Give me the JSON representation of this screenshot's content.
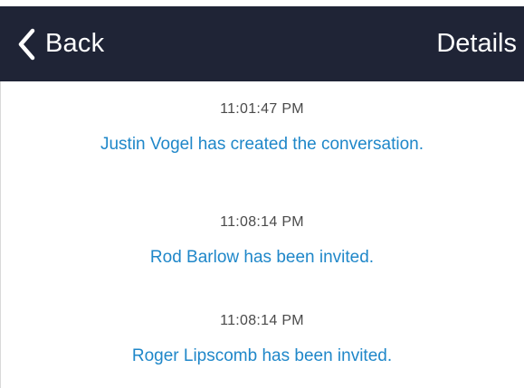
{
  "navbar": {
    "back_label": "Back",
    "details_label": "Details",
    "background": "#1f2436"
  },
  "events": [
    {
      "time": "11:01:47 PM",
      "message": "Justin Vogel has created the conversation."
    },
    {
      "time": "11:08:14 PM",
      "message": "Rod Barlow has been invited."
    },
    {
      "time": "11:08:14 PM",
      "message": "Roger Lipscomb has been invited."
    }
  ],
  "colors": {
    "message_link": "#1f87c9",
    "timestamp": "#4a4a4a"
  },
  "icons": {
    "back": "chevron-left-icon"
  }
}
